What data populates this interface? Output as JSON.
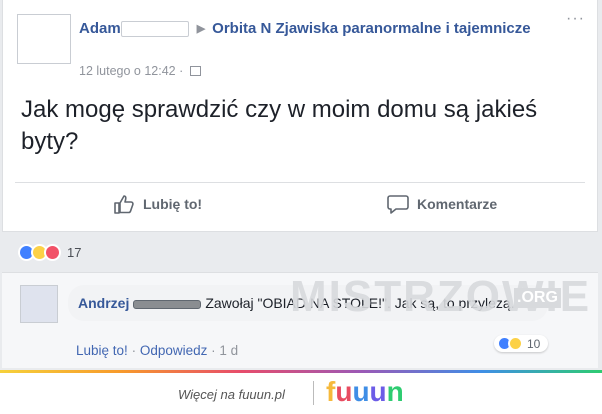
{
  "post": {
    "author": "Adam",
    "group": "Orbita N Zjawiska paranormalne i tajemnicze",
    "timestamp": "12 lutego o 12:42",
    "text": "Jak mogę sprawdzić czy w moim domu są jakieś byty?",
    "menu": "···"
  },
  "actions": {
    "like_label": "Lubię to!",
    "comment_label": "Komentarze"
  },
  "reactions": {
    "count": "17",
    "icons": [
      "like-icon",
      "haha-icon",
      "love-icon"
    ]
  },
  "comment": {
    "author": "Andrzej",
    "text": "Zawołaj \"OBIAD NA STOLE!\". Jak są, to przylezą.",
    "like_label": "Lubię to!",
    "reply_label": "Odpowiedz",
    "time": "1 d",
    "reaction_count": "10"
  },
  "watermark": {
    "text": "MISTRZOWIE",
    "suffix": ".ORG"
  },
  "footer": {
    "tagline": "Więcej na fuuun.pl",
    "logo": [
      "f",
      "u",
      "u",
      "u",
      "n"
    ],
    "logo_colors": [
      "#f6b93b",
      "#e84c61",
      "#3f8ee6",
      "#6c5ce7",
      "#2ecc71"
    ]
  },
  "colors": {
    "link": "#365899",
    "text": "#1d2129",
    "muted": "#90949c"
  }
}
